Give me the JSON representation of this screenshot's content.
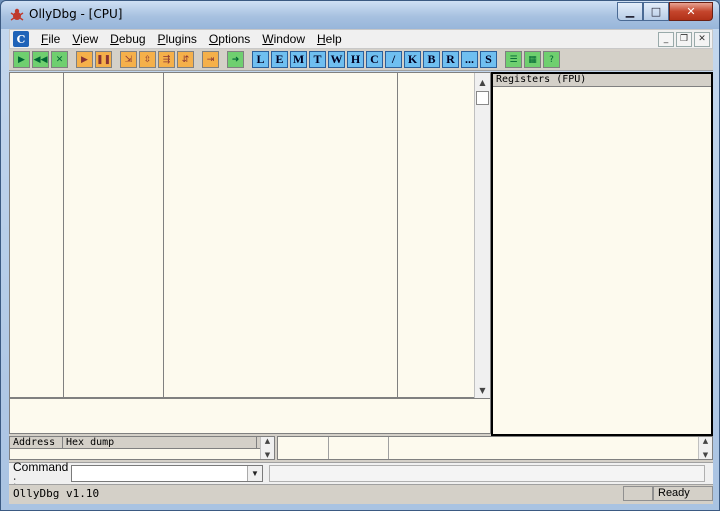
{
  "window": {
    "title": "OllyDbg - [CPU]"
  },
  "menu": [
    {
      "label": "File",
      "mnemonic": "F",
      "rest": "ile"
    },
    {
      "label": "View",
      "mnemonic": "V",
      "rest": "iew"
    },
    {
      "label": "Debug",
      "mnemonic": "D",
      "rest": "ebug"
    },
    {
      "label": "Plugins",
      "mnemonic": "P",
      "rest": "lugins"
    },
    {
      "label": "Options",
      "mnemonic": "O",
      "rest": "ptions"
    },
    {
      "label": "Window",
      "mnemonic": "W",
      "rest": "indow"
    },
    {
      "label": "Help",
      "mnemonic": "H",
      "rest": "elp"
    }
  ],
  "mdi_icon": "C",
  "toolbar": {
    "run_group": [
      {
        "name": "open-icon",
        "glyph": "▶",
        "color": "green"
      },
      {
        "name": "restart-icon",
        "glyph": "◀◀",
        "color": "green"
      },
      {
        "name": "close-program-icon",
        "glyph": "✕",
        "color": "green"
      },
      {
        "name": "run-icon",
        "glyph": "▶",
        "color": "orange"
      },
      {
        "name": "pause-icon",
        "glyph": "❚❚",
        "color": "orange"
      },
      {
        "name": "step-into-icon",
        "glyph": "⇲",
        "color": "orange"
      },
      {
        "name": "step-over-icon",
        "glyph": "⇳",
        "color": "orange"
      },
      {
        "name": "trace-into-icon",
        "glyph": "⇶",
        "color": "orange"
      },
      {
        "name": "trace-over-icon",
        "glyph": "⇵",
        "color": "orange"
      },
      {
        "name": "execute-till-return-icon",
        "glyph": "⇥",
        "color": "orange"
      },
      {
        "name": "go-to-icon",
        "glyph": "➜",
        "color": "green"
      }
    ],
    "windows": [
      "L",
      "E",
      "M",
      "T",
      "W",
      "H",
      "C",
      "/",
      "K",
      "B",
      "R",
      "...",
      "S"
    ],
    "extra": [
      {
        "name": "list-icon",
        "glyph": "☰"
      },
      {
        "name": "grid-icon",
        "glyph": "▦"
      },
      {
        "name": "help-icon",
        "glyph": "?"
      }
    ]
  },
  "registers": {
    "header": "Registers (FPU)"
  },
  "dump": {
    "columns": [
      "Address",
      "Hex dump"
    ]
  },
  "command": {
    "label": "Command :",
    "value": ""
  },
  "status": {
    "left": "OllyDbg v1.10",
    "right": "Ready"
  }
}
